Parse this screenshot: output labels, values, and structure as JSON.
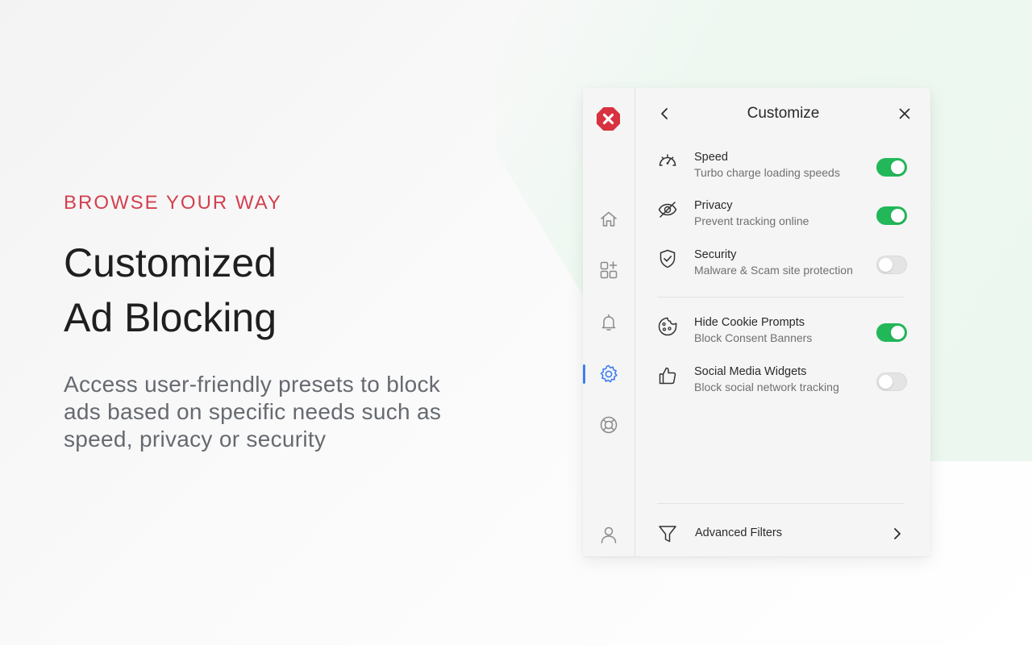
{
  "hero": {
    "eyebrow": "BROWSE YOUR WAY",
    "headline_line1": "Customized",
    "headline_line2": "Ad Blocking",
    "description": "Access user-friendly presets to block ads based on specific needs such as speed, privacy or security"
  },
  "colors": {
    "accent_red": "#d33f4f",
    "toggle_on": "#22b85a",
    "active_nav": "#3d7ff0"
  },
  "panel": {
    "title": "Customize",
    "rail": {
      "items": [
        {
          "name": "home",
          "icon": "home-icon",
          "active": false
        },
        {
          "name": "apps",
          "icon": "apps-add-icon",
          "active": false
        },
        {
          "name": "notifications",
          "icon": "bell-icon",
          "active": false
        },
        {
          "name": "settings",
          "icon": "gear-icon",
          "active": true
        },
        {
          "name": "help",
          "icon": "lifebuoy-icon",
          "active": false
        },
        {
          "name": "account",
          "icon": "user-icon",
          "active": false
        }
      ]
    },
    "settings": [
      {
        "title": "Speed",
        "subtitle": "Turbo charge loading speeds",
        "icon": "speedometer-icon",
        "enabled": true
      },
      {
        "title": "Privacy",
        "subtitle": "Prevent tracking online",
        "icon": "eye-off-icon",
        "enabled": true
      },
      {
        "title": "Security",
        "subtitle": "Malware & Scam site protection",
        "icon": "shield-check-icon",
        "enabled": false
      },
      {
        "title": "Hide Cookie Prompts",
        "subtitle": "Block Consent Banners",
        "icon": "cookie-icon",
        "enabled": true
      },
      {
        "title": "Social Media Widgets",
        "subtitle": "Block social network tracking",
        "icon": "thumbs-up-icon",
        "enabled": false
      }
    ],
    "advanced": {
      "label": "Advanced Filters",
      "icon": "filter-icon"
    }
  }
}
